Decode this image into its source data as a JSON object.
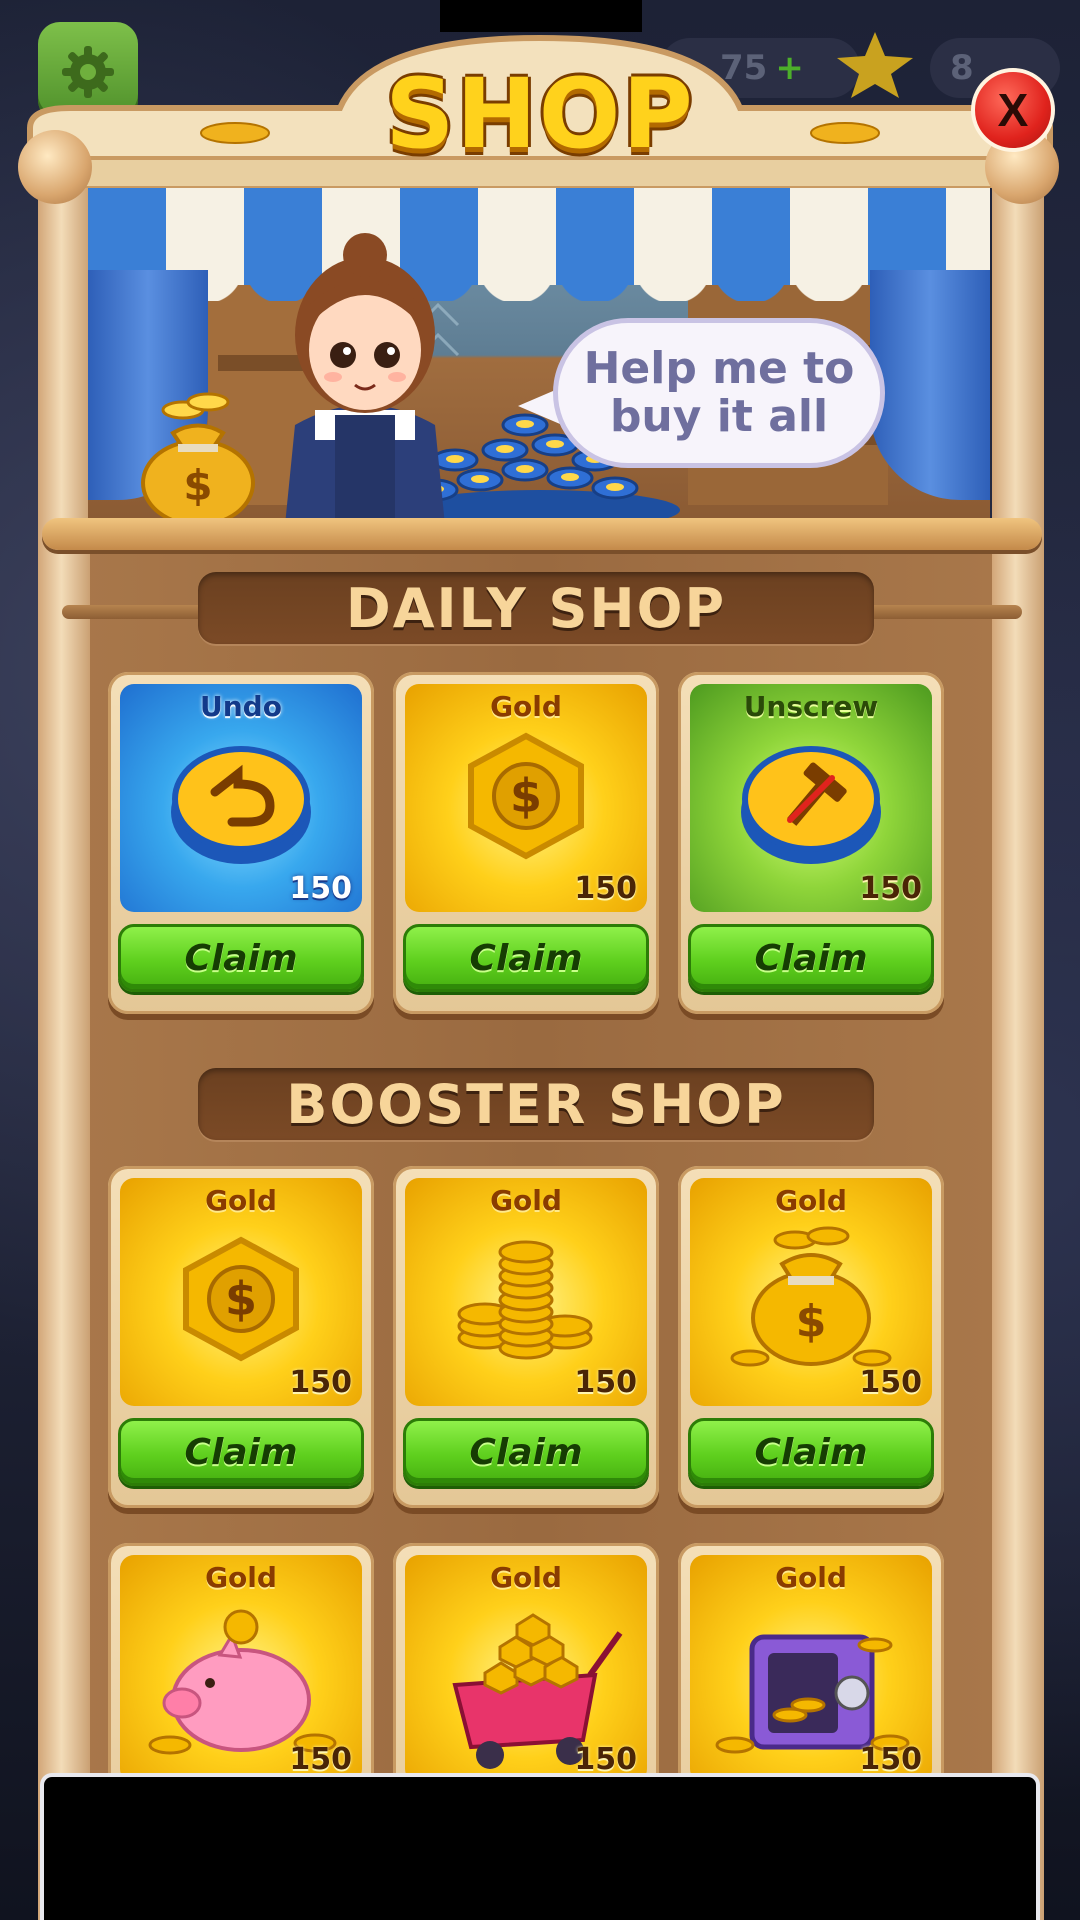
{
  "shop": {
    "title": "SHOP",
    "speech_bubble": "Help me to buy it all",
    "close_label": "X"
  },
  "hud": {
    "coins_partial": "75",
    "stars_partial": "8"
  },
  "daily_shop": {
    "header": "DAILY SHOP",
    "items": [
      {
        "title": "Undo",
        "count": "150",
        "button": "Claim",
        "theme": "blue",
        "icon": "undo-icon"
      },
      {
        "title": "Gold",
        "count": "150",
        "button": "Claim",
        "theme": "gold",
        "icon": "gold-coin-icon"
      },
      {
        "title": "Unscrew",
        "count": "150",
        "button": "Claim",
        "theme": "green",
        "icon": "hammer-icon"
      }
    ]
  },
  "booster_shop": {
    "header": "BOOSTER SHOP",
    "items": [
      {
        "title": "Gold",
        "count": "150",
        "button": "Claim",
        "icon": "gold-coin-icon"
      },
      {
        "title": "Gold",
        "count": "150",
        "button": "Claim",
        "icon": "coin-stack-icon"
      },
      {
        "title": "Gold",
        "count": "150",
        "button": "Claim",
        "icon": "money-bag-icon"
      },
      {
        "title": "Gold",
        "count": "150",
        "icon": "piggy-bank-icon"
      },
      {
        "title": "Gold",
        "count": "150",
        "icon": "coin-cart-icon"
      },
      {
        "title": "Gold",
        "count": "150",
        "icon": "treasure-safe-icon"
      }
    ]
  },
  "colors": {
    "title_yellow": "#ffd21c",
    "claim_green": "#5fd01e",
    "close_red": "#e0231d",
    "wood": "#9a6a40"
  }
}
